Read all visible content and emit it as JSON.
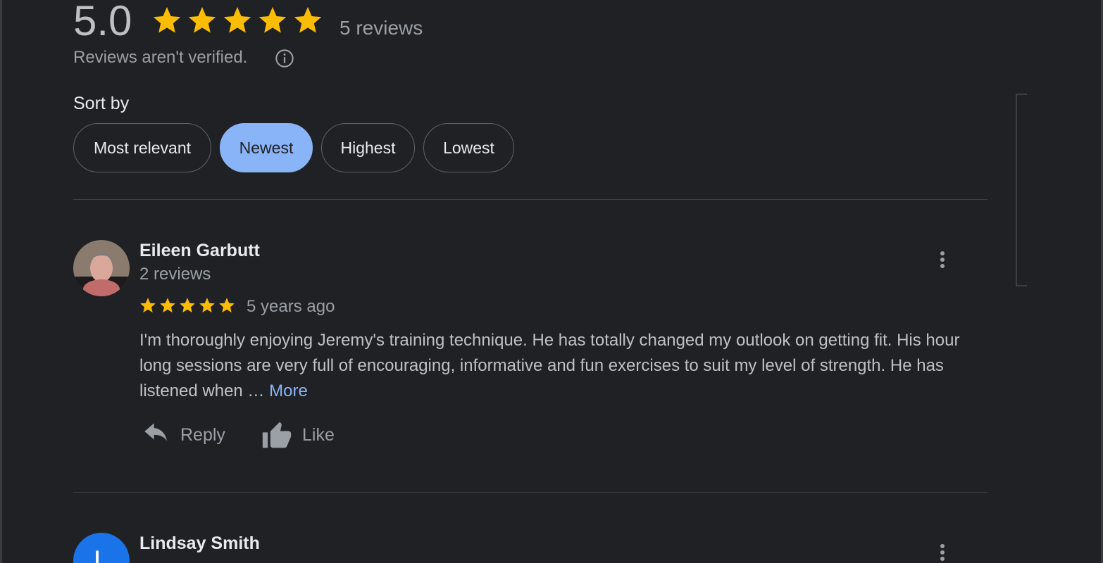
{
  "summary": {
    "rating": "5.0",
    "stars": 5,
    "total_reviews": "5 reviews",
    "verification_note": "Reviews aren't verified."
  },
  "sort": {
    "label": "Sort by",
    "options": [
      "Most relevant",
      "Newest",
      "Highest",
      "Lowest"
    ],
    "selected": "Newest"
  },
  "reviews": [
    {
      "name": "Eileen Garbutt",
      "review_count": "2 reviews",
      "stars": 5,
      "date": "5 years ago",
      "text": "I'm thoroughly enjoying Jeremy's training technique. He has totally changed my outlook on getting fit. His hour long sessions are very full of encouraging, informative and fun exercises to suit my level of strength. He has listened when …",
      "more_label": "More",
      "reply_label": "Reply",
      "like_label": "Like"
    },
    {
      "name": "Lindsay Smith",
      "avatar_letter": "L"
    }
  ],
  "colors": {
    "background": "#202124",
    "star": "#fbbc04",
    "accent": "#8ab4f8",
    "divider": "#3c4043",
    "avatar_blue": "#1a73e8"
  }
}
